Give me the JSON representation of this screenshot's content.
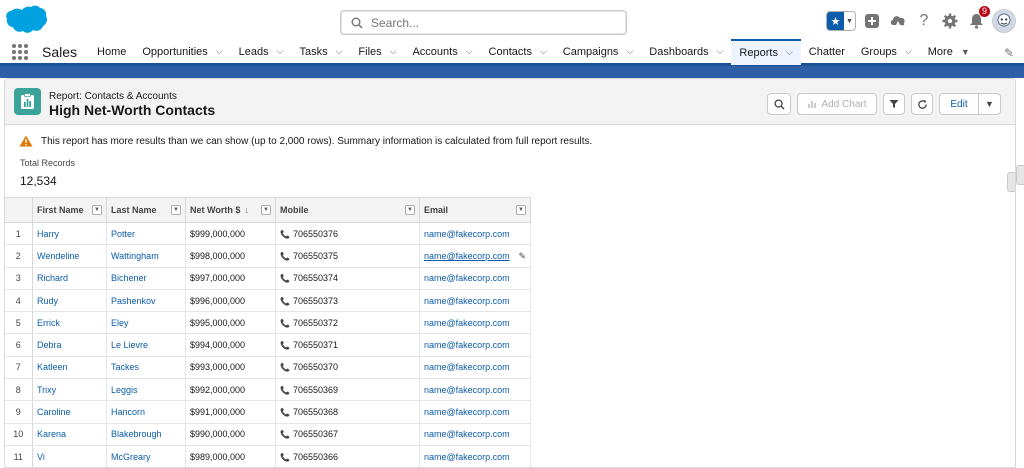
{
  "header": {
    "search_placeholder": "Search...",
    "notification_count": "9"
  },
  "nav": {
    "app_name": "Sales",
    "items": [
      {
        "label": "Home",
        "dropdown": false
      },
      {
        "label": "Opportunities",
        "dropdown": true
      },
      {
        "label": "Leads",
        "dropdown": true
      },
      {
        "label": "Tasks",
        "dropdown": true
      },
      {
        "label": "Files",
        "dropdown": true
      },
      {
        "label": "Accounts",
        "dropdown": true
      },
      {
        "label": "Contacts",
        "dropdown": true
      },
      {
        "label": "Campaigns",
        "dropdown": true
      },
      {
        "label": "Dashboards",
        "dropdown": true
      },
      {
        "label": "Reports",
        "dropdown": true,
        "active": true
      },
      {
        "label": "Chatter",
        "dropdown": false
      },
      {
        "label": "Groups",
        "dropdown": true
      },
      {
        "label": "More",
        "dropdown": true
      }
    ]
  },
  "report": {
    "type_label": "Report: Contacts & Accounts",
    "title": "High Net-Worth Contacts",
    "add_chart_label": "Add Chart",
    "edit_label": "Edit",
    "warning": "This report has more results than we can show (up to 2,000 rows). Summary information is calculated from full report results.",
    "total_label": "Total Records",
    "total_value": "12,534"
  },
  "table": {
    "columns": [
      "First Name",
      "Last Name",
      "Net Worth $",
      "Mobile",
      "Email"
    ],
    "sorted_column": "Net Worth $",
    "rows": [
      {
        "n": "1",
        "first": "Harry",
        "last": "Potter",
        "worth": "$999,000,000",
        "mobile": "706550376",
        "email": "name@fakecorp.com"
      },
      {
        "n": "2",
        "first": "Wendeline",
        "last": "Wattingham",
        "worth": "$998,000,000",
        "mobile": "706550375",
        "email": "name@fakecorp.com",
        "hover": true
      },
      {
        "n": "3",
        "first": "Richard",
        "last": "Bichener",
        "worth": "$997,000,000",
        "mobile": "706550374",
        "email": "name@fakecorp.com"
      },
      {
        "n": "4",
        "first": "Rudy",
        "last": "Pashenkov",
        "worth": "$996,000,000",
        "mobile": "706550373",
        "email": "name@fakecorp.com"
      },
      {
        "n": "5",
        "first": "Errick",
        "last": "Eley",
        "worth": "$995,000,000",
        "mobile": "706550372",
        "email": "name@fakecorp.com"
      },
      {
        "n": "6",
        "first": "Debra",
        "last": "Le Lievre",
        "worth": "$994,000,000",
        "mobile": "706550371",
        "email": "name@fakecorp.com"
      },
      {
        "n": "7",
        "first": "Katleen",
        "last": "Tackes",
        "worth": "$993,000,000",
        "mobile": "706550370",
        "email": "name@fakecorp.com"
      },
      {
        "n": "8",
        "first": "Trixy",
        "last": "Leggis",
        "worth": "$992,000,000",
        "mobile": "706550369",
        "email": "name@fakecorp.com"
      },
      {
        "n": "9",
        "first": "Caroline",
        "last": "Hancorn",
        "worth": "$991,000,000",
        "mobile": "706550368",
        "email": "name@fakecorp.com"
      },
      {
        "n": "10",
        "first": "Karena",
        "last": "Blakebrough",
        "worth": "$990,000,000",
        "mobile": "706550367",
        "email": "name@fakecorp.com"
      },
      {
        "n": "11",
        "first": "Vi",
        "last": "McGreary",
        "worth": "$989,000,000",
        "mobile": "706550366",
        "email": "name@fakecorp.com"
      }
    ]
  }
}
